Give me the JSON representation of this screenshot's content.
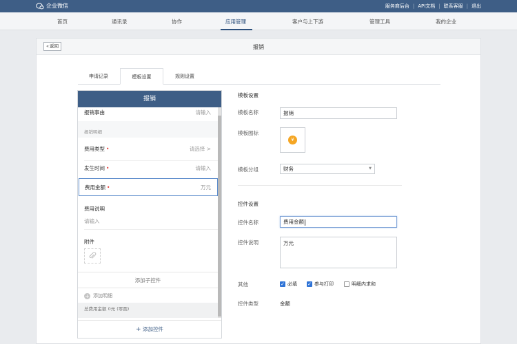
{
  "topbar": {
    "brand": "企业微信",
    "links": [
      "服务商后台",
      "API文档",
      "联系客服",
      "退出"
    ]
  },
  "nav": {
    "items": [
      "首页",
      "通讯录",
      "协作",
      "应用管理",
      "客户与上下游",
      "管理工具",
      "我的企业"
    ],
    "active": "应用管理"
  },
  "page": {
    "back_label": "返回",
    "title": "报销",
    "tabs": [
      "申请记录",
      "模板设置",
      "规则设置"
    ],
    "active_tab": "模板设置"
  },
  "preview": {
    "header": "报销",
    "reason_label": "报销事由",
    "reason_placeholder": "请输入",
    "detail_section": "报销明细",
    "fields": [
      {
        "label": "费用类型",
        "value": "请选择",
        "required": true
      },
      {
        "label": "发生时间",
        "value": "请输入",
        "required": true
      },
      {
        "label": "费用金额",
        "value": "万元",
        "required": true
      }
    ],
    "desc_label": "费用说明",
    "desc_placeholder": "请输入",
    "attachment_label": "附件",
    "add_sub_control": "添加子控件",
    "add_detail": "添加明细",
    "total_text": "总费用金额   0元 (零圆)",
    "add_control": "添加控件"
  },
  "template_settings": {
    "section": "模板设置",
    "name_label": "模板名称",
    "name_value": "报销",
    "icon_label": "模板图标",
    "icon_glyph": "¥",
    "group_label": "模板分组",
    "group_value": "财务"
  },
  "control_settings": {
    "section": "控件设置",
    "name_label": "控件名称",
    "name_value": "费用金额",
    "desc_label": "控件说明",
    "desc_value": "万元",
    "other_label": "其他",
    "options": [
      {
        "label": "必填",
        "checked": true
      },
      {
        "label": "参与打印",
        "checked": true
      },
      {
        "label": "明细内求和",
        "checked": false
      }
    ],
    "type_label": "控件类型",
    "type_value": "金额"
  },
  "colors": {
    "topbar": "#3e5e86",
    "accent": "#2f73d6",
    "required": "#e53935",
    "icon_orange": "#f5a623"
  }
}
